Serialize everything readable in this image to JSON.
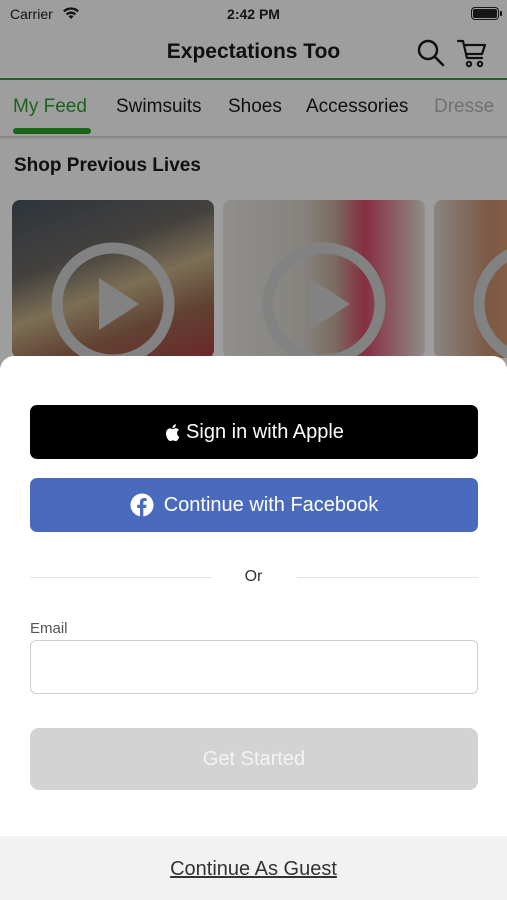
{
  "status_bar": {
    "carrier": "Carrier",
    "time": "2:42 PM"
  },
  "header": {
    "title": "Expectations Too",
    "icons": [
      "search-icon",
      "cart-icon"
    ]
  },
  "tabs": [
    {
      "label": "My Feed",
      "active": true
    },
    {
      "label": "Swimsuits"
    },
    {
      "label": "Shoes"
    },
    {
      "label": "Accessories"
    },
    {
      "label": "Dresse"
    }
  ],
  "section": {
    "title": "Shop Previous Lives"
  },
  "videos": [
    {
      "icon": "play-icon"
    },
    {
      "icon": "play-icon"
    },
    {
      "icon": "play-icon"
    }
  ],
  "sheet": {
    "apple_label": "Sign in with Apple",
    "facebook_label": "Continue with Facebook",
    "or_label": "Or",
    "email_label": "Email",
    "email_value": "",
    "get_started_label": "Get Started",
    "guest_label": "Continue As Guest"
  },
  "colors": {
    "accent_green": "#2ea02e",
    "facebook_blue": "#4a6bbd",
    "disabled_gray": "#d3d3d3"
  }
}
